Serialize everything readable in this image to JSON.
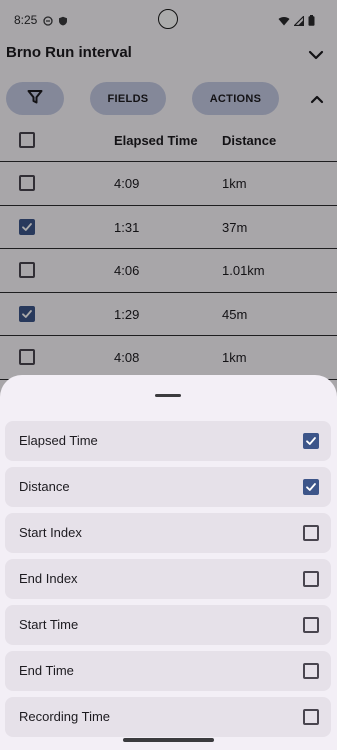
{
  "status_bar": {
    "time": "8:25",
    "left_icons": [
      "vpn-icon",
      "shield-icon"
    ],
    "right_icons": [
      "wifi-icon",
      "signal-icon",
      "battery-icon"
    ]
  },
  "app_bar": {
    "title": "Brno Run interval",
    "collapse_icon": "chevron-down-icon"
  },
  "toolbar": {
    "filter_icon": "filter-icon",
    "fields_label": "FIELDS",
    "actions_label": "ACTIONS",
    "expand_icon": "chevron-up-icon"
  },
  "table": {
    "columns": [
      "Elapsed Time",
      "Distance"
    ],
    "rows": [
      {
        "elapsed": "4:09",
        "distance": "1km",
        "checked": false
      },
      {
        "elapsed": "1:31",
        "distance": "37m",
        "checked": true
      },
      {
        "elapsed": "4:06",
        "distance": "1.01km",
        "checked": false
      },
      {
        "elapsed": "1:29",
        "distance": "45m",
        "checked": true
      },
      {
        "elapsed": "4:08",
        "distance": "1km",
        "checked": false
      }
    ]
  },
  "sheet": {
    "fields": [
      {
        "label": "Elapsed Time",
        "checked": true
      },
      {
        "label": "Distance",
        "checked": true
      },
      {
        "label": "Start Index",
        "checked": false
      },
      {
        "label": "End Index",
        "checked": false
      },
      {
        "label": "Start Time",
        "checked": false
      },
      {
        "label": "End Time",
        "checked": false
      },
      {
        "label": "Recording Time",
        "checked": false
      }
    ]
  },
  "colors": {
    "accent": "#3d5589",
    "pill": "#c5cbe5",
    "sheet": "#f3eff6",
    "field_item": "#e6e1e9"
  }
}
